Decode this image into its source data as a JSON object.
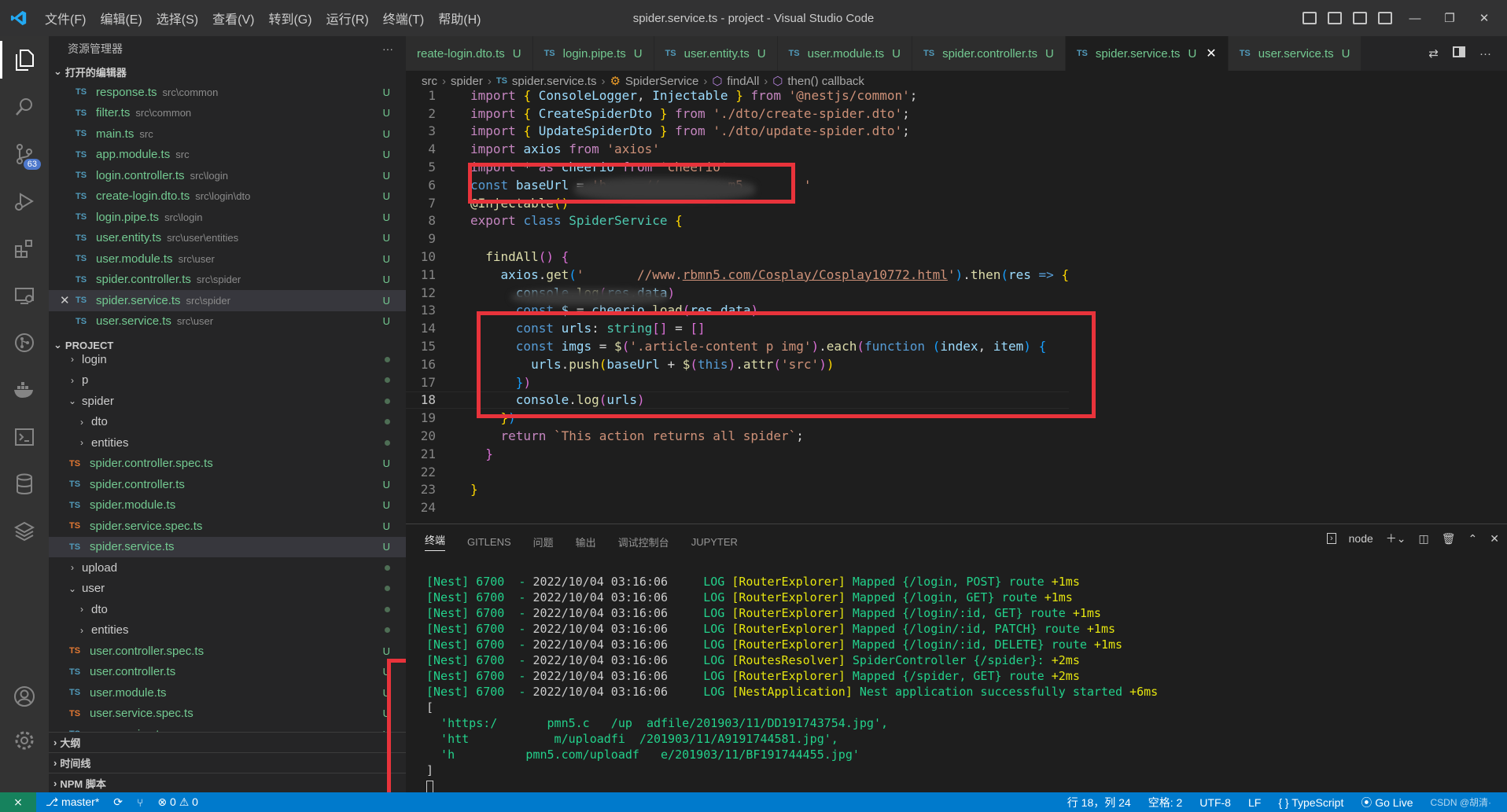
{
  "titlebar": {
    "menu": [
      "文件(F)",
      "编辑(E)",
      "选择(S)",
      "查看(V)",
      "转到(G)",
      "运行(R)",
      "终端(T)",
      "帮助(H)"
    ],
    "title": "spider.service.ts - project - Visual Studio Code"
  },
  "activitybar": {
    "scm_badge": "63"
  },
  "sidebar": {
    "header": "资源管理器",
    "more": "···",
    "open_editors_label": "打开的编辑器",
    "open_editors": [
      {
        "name": "response.ts",
        "path": "src\\common",
        "status": "U"
      },
      {
        "name": "filter.ts",
        "path": "src\\common",
        "status": "U"
      },
      {
        "name": "main.ts",
        "path": "src",
        "status": "U"
      },
      {
        "name": "app.module.ts",
        "path": "src",
        "status": "U"
      },
      {
        "name": "login.controller.ts",
        "path": "src\\login",
        "status": "U"
      },
      {
        "name": "create-login.dto.ts",
        "path": "src\\login\\dto",
        "status": "U"
      },
      {
        "name": "login.pipe.ts",
        "path": "src\\login",
        "status": "U"
      },
      {
        "name": "user.entity.ts",
        "path": "src\\user\\entities",
        "status": "U"
      },
      {
        "name": "user.module.ts",
        "path": "src\\user",
        "status": "U"
      },
      {
        "name": "spider.controller.ts",
        "path": "src\\spider",
        "status": "U"
      },
      {
        "name": "spider.service.ts",
        "path": "src\\spider",
        "status": "U"
      },
      {
        "name": "user.service.ts",
        "path": "src\\user",
        "status": "U"
      }
    ],
    "project_label": "PROJECT",
    "project_tree": [
      {
        "name": "login",
        "kind": "folder",
        "chev": "›"
      },
      {
        "name": "p",
        "kind": "folder",
        "chev": "›"
      },
      {
        "name": "spider",
        "kind": "folder",
        "chev": "⌄"
      },
      {
        "name": "dto",
        "kind": "folder2",
        "chev": "›"
      },
      {
        "name": "entities",
        "kind": "folder2",
        "chev": "›"
      },
      {
        "name": "spider.controller.spec.ts",
        "kind": "spec",
        "status": "U"
      },
      {
        "name": "spider.controller.ts",
        "kind": "file",
        "status": "U"
      },
      {
        "name": "spider.module.ts",
        "kind": "file",
        "status": "U"
      },
      {
        "name": "spider.service.spec.ts",
        "kind": "spec",
        "status": "U"
      },
      {
        "name": "spider.service.ts",
        "kind": "file",
        "status": "U"
      },
      {
        "name": "upload",
        "kind": "folder",
        "chev": "›"
      },
      {
        "name": "user",
        "kind": "folder",
        "chev": "⌄"
      },
      {
        "name": "dto",
        "kind": "folder2",
        "chev": "›"
      },
      {
        "name": "entities",
        "kind": "folder2",
        "chev": "›"
      },
      {
        "name": "user.controller.spec.ts",
        "kind": "spec",
        "status": "U"
      },
      {
        "name": "user.controller.ts",
        "kind": "file",
        "status": "U"
      },
      {
        "name": "user.module.ts",
        "kind": "file",
        "status": "U"
      },
      {
        "name": "user.service.spec.ts",
        "kind": "spec",
        "status": "U"
      },
      {
        "name": "user.service.ts",
        "kind": "file",
        "status": "U"
      }
    ],
    "outline_label": "大纲",
    "timeline_label": "时间线",
    "npm_label": "NPM 脚本"
  },
  "tabs": [
    {
      "name": "reate-login.dto.ts",
      "status": "U",
      "ts": false
    },
    {
      "name": "login.pipe.ts",
      "status": "U",
      "ts": true
    },
    {
      "name": "user.entity.ts",
      "status": "U",
      "ts": true
    },
    {
      "name": "user.module.ts",
      "status": "U",
      "ts": true
    },
    {
      "name": "spider.controller.ts",
      "status": "U",
      "ts": true
    },
    {
      "name": "spider.service.ts",
      "status": "U",
      "ts": true,
      "active": true
    },
    {
      "name": "user.service.ts",
      "status": "U",
      "ts": true
    }
  ],
  "breadcrumb": [
    "src",
    "spider",
    "spider.service.ts",
    "SpiderService",
    "findAll",
    "then() callback"
  ],
  "code": {
    "line_numbers": [
      "1",
      "2",
      "3",
      "4",
      "5",
      "6",
      "7",
      "8",
      "9",
      "10",
      "11",
      "12",
      "13",
      "14",
      "15",
      "16",
      "17",
      "18",
      "19",
      "20",
      "21",
      "22",
      "23",
      "24"
    ]
  },
  "panel": {
    "tabs": [
      "终端",
      "GITLENS",
      "问题",
      "输出",
      "调试控制台",
      "JUPYTER"
    ],
    "terminal_name": "node",
    "log_lines": [
      {
        "prefix": "[Nest] 6700  - ",
        "time": "2022/10/04 03:16:06",
        "level": "LOG",
        "ctx": "[RouterExplorer]",
        "msg": " Mapped {/login, POST} route ",
        "ms": "+1ms"
      },
      {
        "prefix": "[Nest] 6700  - ",
        "time": "2022/10/04 03:16:06",
        "level": "LOG",
        "ctx": "[RouterExplorer]",
        "msg": " Mapped {/login, GET} route ",
        "ms": "+1ms"
      },
      {
        "prefix": "[Nest] 6700  - ",
        "time": "2022/10/04 03:16:06",
        "level": "LOG",
        "ctx": "[RouterExplorer]",
        "msg": " Mapped {/login/:id, GET} route ",
        "ms": "+1ms"
      },
      {
        "prefix": "[Nest] 6700  - ",
        "time": "2022/10/04 03:16:06",
        "level": "LOG",
        "ctx": "[RouterExplorer]",
        "msg": " Mapped {/login/:id, PATCH} route ",
        "ms": "+1ms"
      },
      {
        "prefix": "[Nest] 6700  - ",
        "time": "2022/10/04 03:16:06",
        "level": "LOG",
        "ctx": "[RouterExplorer]",
        "msg": " Mapped {/login/:id, DELETE} route ",
        "ms": "+1ms"
      },
      {
        "prefix": "[Nest] 6700  - ",
        "time": "2022/10/04 03:16:06",
        "level": "LOG",
        "ctx": "[RoutesResolver]",
        "msg": " SpiderController {/spider}: ",
        "ms": "+2ms"
      },
      {
        "prefix": "[Nest] 6700  - ",
        "time": "2022/10/04 03:16:06",
        "level": "LOG",
        "ctx": "[RouterExplorer]",
        "msg": " Mapped {/spider, GET} route ",
        "ms": "+2ms"
      },
      {
        "prefix": "[Nest] 6700  - ",
        "time": "2022/10/04 03:16:06",
        "level": "LOG",
        "ctx": "[NestApplication]",
        "msg": " Nest application successfully started ",
        "ms": "+6ms"
      }
    ],
    "output_lines": [
      "[",
      "  'https:/       pmn5.c   /up  adfile/201903/11/DD191743754.jpg',",
      "  'htt            m/uploadfi  /201903/11/A9191744581.jpg',",
      "  'h          pmn5.com/uploadf   e/201903/11/BF191744455.jpg'",
      "]"
    ]
  },
  "statusbar": {
    "branch": "master*",
    "errors": "0",
    "warnings": "0",
    "position": "行 18，列 24",
    "spaces": "空格: 2",
    "encoding": "UTF-8",
    "eol": "LF",
    "language": "TypeScript",
    "golive": "Go Live",
    "watermark": "CSDN @胡清·"
  },
  "colors": {
    "highlight": "#e8333b",
    "statusbar": "#007acc",
    "added": "#73c991"
  }
}
